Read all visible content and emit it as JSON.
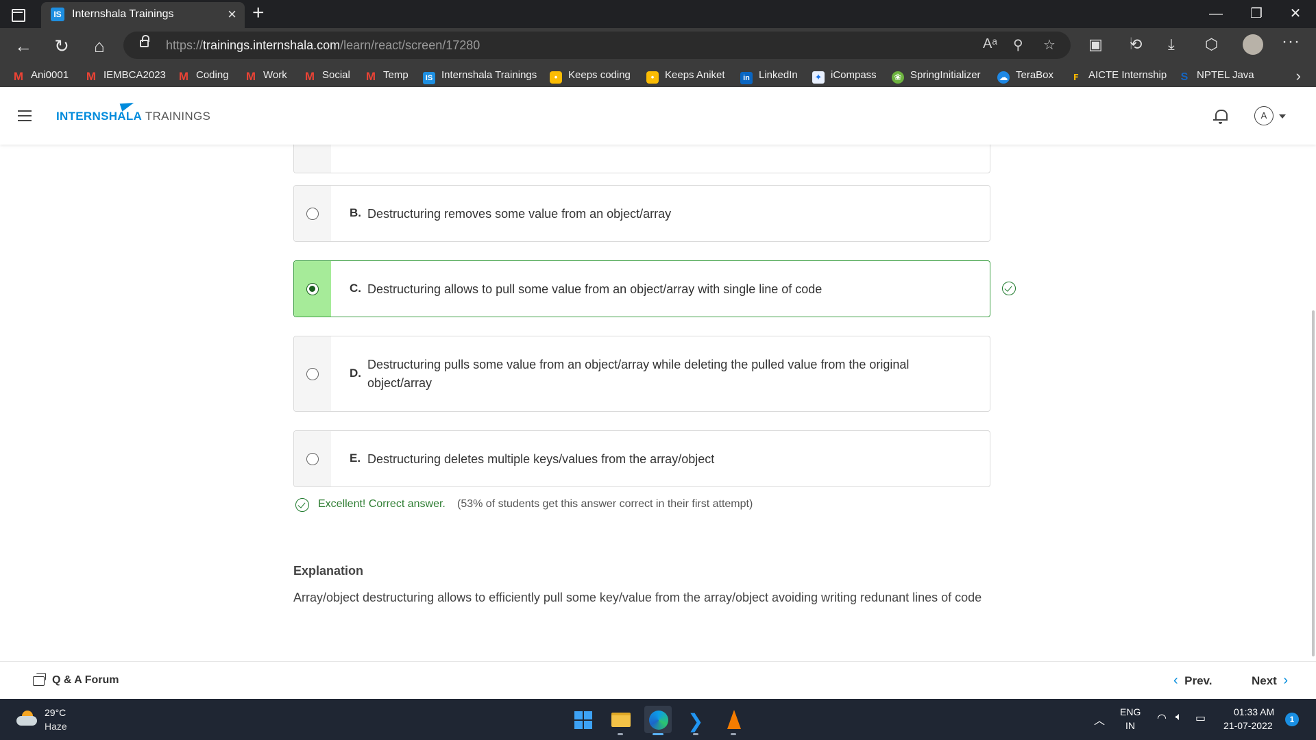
{
  "browser": {
    "tab_favicon": "IS",
    "tab_title": "Internshala Trainings",
    "tab_close": "×",
    "new_tab": "+",
    "url_prefix": "https://",
    "url_host": "trainings.internshala.com",
    "url_path": "/learn/react/screen/17280",
    "read_aloud": "Aᵃ",
    "bookmarks": [
      {
        "label": "Ani0001",
        "icon": "gmail-icon",
        "glyph": "M"
      },
      {
        "label": "IEMBCA2023",
        "icon": "gmail-icon",
        "glyph": "M"
      },
      {
        "label": "Coding",
        "icon": "gmail-icon",
        "glyph": "M"
      },
      {
        "label": "Work",
        "icon": "gmail-icon",
        "glyph": "M"
      },
      {
        "label": "Social",
        "icon": "gmail-icon",
        "glyph": "M"
      },
      {
        "label": "Temp",
        "icon": "gmail-icon",
        "glyph": "M"
      },
      {
        "label": "Internshala Trainings",
        "icon": "internshala-icon",
        "glyph": "IS"
      },
      {
        "label": "Keeps coding",
        "icon": "keep-icon",
        "glyph": "•"
      },
      {
        "label": "Keeps Aniket",
        "icon": "keep-icon",
        "glyph": "•"
      },
      {
        "label": "LinkedIn",
        "icon": "linkedin-icon",
        "glyph": "in"
      },
      {
        "label": "iCompass",
        "icon": "compass-icon",
        "glyph": "✦"
      },
      {
        "label": "SpringInitializer",
        "icon": "spring-icon",
        "glyph": "❀"
      },
      {
        "label": "TeraBox",
        "icon": "terabox-icon",
        "glyph": "☁"
      },
      {
        "label": "AICTE Internship",
        "icon": "aicte-icon",
        "glyph": "ꜰ"
      },
      {
        "label": "NPTEL Java",
        "icon": "nptel-icon",
        "glyph": "S"
      }
    ]
  },
  "header": {
    "logo_part1": "INTERNSHALA",
    "logo_part2": " TRAININGS",
    "avatar_initial": "A"
  },
  "quiz": {
    "options": [
      {
        "letter": "B.",
        "text": "Destructuring removes some value from an object/array",
        "selected": false,
        "correct": false
      },
      {
        "letter": "C.",
        "text": "Destructuring allows to pull some value from an object/array with single line of code",
        "selected": true,
        "correct": true
      },
      {
        "letter": "D.",
        "text": "Destructuring pulls some value from an object/array while deleting the pulled value from the original object/array",
        "selected": false,
        "correct": false
      },
      {
        "letter": "E.",
        "text": "Destructuring deletes multiple keys/values from the array/object",
        "selected": false,
        "correct": false
      }
    ],
    "feedback": "Excellent! Correct answer.",
    "stat": "(53% of students get this answer correct in their first attempt)",
    "explanation_title": "Explanation",
    "explanation_text": "Array/object destructuring allows to efficiently pull some key/value from the array/object avoiding writing redunant lines of code"
  },
  "footer": {
    "forum_label": "Q & A Forum",
    "prev_label": "Prev.",
    "next_label": "Next"
  },
  "taskbar": {
    "temperature": "29°C",
    "condition": "Haze",
    "lang_line1": "ENG",
    "lang_line2": "IN",
    "time": "01:33 AM",
    "date": "21-07-2022",
    "notification_count": "1"
  },
  "colors": {
    "brand": "#008bdc",
    "correct_border": "#3fa046",
    "correct_fill": "#a6eb99",
    "correct_text": "#2e7d32"
  }
}
